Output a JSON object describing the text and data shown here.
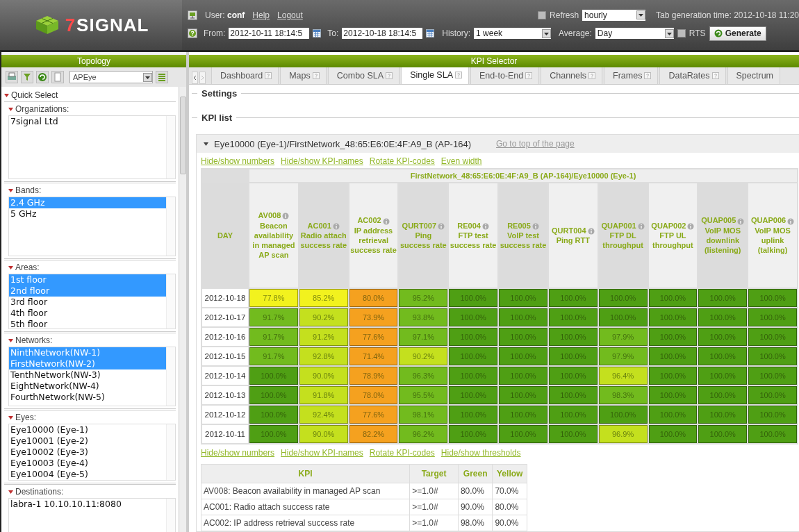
{
  "header": {
    "logo_mark": "7",
    "logo_text": "SIGNAL",
    "user": "User: **conf**",
    "links": [
      "Help",
      "Logout"
    ],
    "refresh": {
      "label": "Refresh",
      "checked": false
    },
    "refresh_select": "hourly",
    "generation_time": "Tab generation time: 2012-10-18 11:20",
    "from": {
      "label": "From:",
      "value": "2012-10-11 18:14:5"
    },
    "to": {
      "label": "To:",
      "value": "2012-10-18 18:14:5"
    },
    "history": {
      "label": "History:",
      "value": "1 week"
    },
    "average": {
      "label": "Average:",
      "value": "Day"
    },
    "rts": {
      "label": "RTS",
      "checked": false
    },
    "generate_button": "Generate"
  },
  "sidebar": {
    "title": "Topology",
    "view_select": "APEye",
    "quick_select": "Quick Select",
    "groups": [
      {
        "label": "Organizations:",
        "items": [
          {
            "text": "7signal Ltd",
            "selected": false
          }
        ]
      },
      {
        "label": "Bands:",
        "items": [
          {
            "text": "2.4 GHz",
            "selected": true
          },
          {
            "text": "5 GHz",
            "selected": false
          }
        ]
      },
      {
        "label": "Areas:",
        "items": [
          {
            "text": "1st floor",
            "selected": true
          },
          {
            "text": "2nd floor",
            "selected": true
          },
          {
            "text": "3rd floor",
            "selected": false
          },
          {
            "text": "4th floor",
            "selected": false
          },
          {
            "text": "5th floor",
            "selected": false
          }
        ]
      },
      {
        "label": "Networks:",
        "items": [
          {
            "text": "NinthNetwork(NW-1)",
            "selected": true
          },
          {
            "text": "FirstNetwork(NW-2)",
            "selected": true
          },
          {
            "text": "TenthNetwork(NW-3)",
            "selected": false
          },
          {
            "text": "EightNetwork(NW-4)",
            "selected": false
          },
          {
            "text": "FourthNetwork(NW-5)",
            "selected": false
          }
        ]
      },
      {
        "label": "Eyes:",
        "items": [
          {
            "text": "Eye10000 (Eye-1)",
            "selected": false
          },
          {
            "text": "Eye10001 (Eye-2)",
            "selected": false
          },
          {
            "text": "Eye10002 (Eye-3)",
            "selected": false
          },
          {
            "text": "Eye10003 (Eye-4)",
            "selected": false
          },
          {
            "text": "Eye10004 (Eye-5)",
            "selected": false
          }
        ]
      },
      {
        "label": "Destinations:",
        "items": [
          {
            "text": "labra-1 10.10.10.11:8080",
            "selected": false
          }
        ]
      }
    ]
  },
  "main": {
    "title": "KPI Selector",
    "tabs": [
      {
        "label": "Dashboard",
        "selected": false
      },
      {
        "label": "Maps",
        "selected": false
      },
      {
        "label": "Combo SLA",
        "selected": false
      },
      {
        "label": "Single SLA",
        "selected": true
      },
      {
        "label": "End-to-End",
        "selected": false
      },
      {
        "label": "Channels",
        "selected": false
      },
      {
        "label": "Frames",
        "selected": false
      },
      {
        "label": "DataRates",
        "selected": false
      },
      {
        "label": "Spectrum",
        "selected": false
      }
    ],
    "settings": "Settings",
    "kpi_list": "KPI list",
    "panel": {
      "title": "Eye10000 (Eye-1)/FirstNetwork_48:65:E6:0E:4F:A9_B (AP-164)",
      "top_link": "Go to top of the page",
      "links_top": [
        "Hide/show numbers",
        "Hide/show KPI-names",
        "Rotate KPI-codes",
        "Even width"
      ],
      "table": {
        "group_header": "FirstNetwork_48:65:E6:0E:4F:A9_B (AP-164)/Eye10000 (Eye-1)",
        "day_header": "DAY",
        "columns": [
          {
            "code": "AV008",
            "name": "Beacon availability in managed AP scan"
          },
          {
            "code": "AC001",
            "name": "Radio attach success rate"
          },
          {
            "code": "AC002",
            "name": "IP address retrieval success rate"
          },
          {
            "code": "QURT007",
            "name": "Ping success rate"
          },
          {
            "code": "RE004",
            "name": "FTP test success rate"
          },
          {
            "code": "RE005",
            "name": "VoIP test success rate"
          },
          {
            "code": "QURT004",
            "name": "Ping RTT"
          },
          {
            "code": "QUAP001",
            "name": "FTP DL throughput"
          },
          {
            "code": "QUAP002",
            "name": "FTP UL throughput"
          },
          {
            "code": "QUAP005",
            "name": "VoIP MOS downlink (listening)"
          },
          {
            "code": "QUAP006",
            "name": "VoIP MOS uplink (talking)"
          }
        ],
        "rows": [
          {
            "day": "2012-10-18",
            "cells": [
              {
                "value": "77.8%",
                "color": "#f2f21e"
              },
              {
                "value": "85.2%",
                "color": "#f2f21e"
              },
              {
                "value": "80.0%",
                "color": "#f5a11f"
              },
              {
                "value": "95.2%",
                "color": "#72bb1e"
              },
              {
                "value": "100.0%",
                "color": "#4f9f14"
              },
              {
                "value": "100.0%",
                "color": "#4f9f14"
              },
              {
                "value": "100.0%",
                "color": "#4f9f14"
              },
              {
                "value": "100.0%",
                "color": "#4f9f14"
              },
              {
                "value": "100.0%",
                "color": "#4f9f14"
              },
              {
                "value": "100.0%",
                "color": "#4f9f14"
              },
              {
                "value": "100.0%",
                "color": "#4f9f14"
              }
            ]
          },
          {
            "day": "2012-10-17",
            "cells": [
              {
                "value": "91.7%",
                "color": "#72bb1e"
              },
              {
                "value": "90.2%",
                "color": "#c4e01e"
              },
              {
                "value": "73.9%",
                "color": "#f5a11f"
              },
              {
                "value": "93.8%",
                "color": "#72bb1e"
              },
              {
                "value": "100.0%",
                "color": "#4f9f14"
              },
              {
                "value": "100.0%",
                "color": "#4f9f14"
              },
              {
                "value": "100.0%",
                "color": "#4f9f14"
              },
              {
                "value": "100.0%",
                "color": "#4f9f14"
              },
              {
                "value": "100.0%",
                "color": "#4f9f14"
              },
              {
                "value": "100.0%",
                "color": "#4f9f14"
              },
              {
                "value": "100.0%",
                "color": "#4f9f14"
              }
            ]
          },
          {
            "day": "2012-10-16",
            "cells": [
              {
                "value": "91.7%",
                "color": "#72bb1e"
              },
              {
                "value": "91.2%",
                "color": "#c4e01e"
              },
              {
                "value": "77.6%",
                "color": "#f5a11f"
              },
              {
                "value": "97.1%",
                "color": "#72bb1e"
              },
              {
                "value": "100.0%",
                "color": "#4f9f14"
              },
              {
                "value": "100.0%",
                "color": "#4f9f14"
              },
              {
                "value": "100.0%",
                "color": "#4f9f14"
              },
              {
                "value": "97.9%",
                "color": "#72bb1e"
              },
              {
                "value": "100.0%",
                "color": "#4f9f14"
              },
              {
                "value": "100.0%",
                "color": "#4f9f14"
              },
              {
                "value": "100.0%",
                "color": "#4f9f14"
              }
            ]
          },
          {
            "day": "2012-10-15",
            "cells": [
              {
                "value": "91.7%",
                "color": "#72bb1e"
              },
              {
                "value": "92.8%",
                "color": "#c4e01e"
              },
              {
                "value": "71.4%",
                "color": "#f5a11f"
              },
              {
                "value": "90.2%",
                "color": "#c4e01e"
              },
              {
                "value": "100.0%",
                "color": "#4f9f14"
              },
              {
                "value": "100.0%",
                "color": "#4f9f14"
              },
              {
                "value": "100.0%",
                "color": "#4f9f14"
              },
              {
                "value": "97.9%",
                "color": "#72bb1e"
              },
              {
                "value": "100.0%",
                "color": "#4f9f14"
              },
              {
                "value": "100.0%",
                "color": "#4f9f14"
              },
              {
                "value": "100.0%",
                "color": "#4f9f14"
              }
            ]
          },
          {
            "day": "2012-10-14",
            "cells": [
              {
                "value": "100.0%",
                "color": "#4f9f14"
              },
              {
                "value": "90.0%",
                "color": "#c4e01e"
              },
              {
                "value": "78.9%",
                "color": "#f5a11f"
              },
              {
                "value": "96.3%",
                "color": "#72bb1e"
              },
              {
                "value": "100.0%",
                "color": "#4f9f14"
              },
              {
                "value": "100.0%",
                "color": "#4f9f14"
              },
              {
                "value": "100.0%",
                "color": "#4f9f14"
              },
              {
                "value": "96.4%",
                "color": "#c4e01e"
              },
              {
                "value": "100.0%",
                "color": "#4f9f14"
              },
              {
                "value": "100.0%",
                "color": "#4f9f14"
              },
              {
                "value": "100.0%",
                "color": "#4f9f14"
              }
            ]
          },
          {
            "day": "2012-10-13",
            "cells": [
              {
                "value": "100.0%",
                "color": "#4f9f14"
              },
              {
                "value": "91.8%",
                "color": "#c4e01e"
              },
              {
                "value": "78.0%",
                "color": "#f5a11f"
              },
              {
                "value": "95.5%",
                "color": "#72bb1e"
              },
              {
                "value": "100.0%",
                "color": "#4f9f14"
              },
              {
                "value": "100.0%",
                "color": "#4f9f14"
              },
              {
                "value": "100.0%",
                "color": "#4f9f14"
              },
              {
                "value": "98.3%",
                "color": "#72bb1e"
              },
              {
                "value": "100.0%",
                "color": "#4f9f14"
              },
              {
                "value": "100.0%",
                "color": "#4f9f14"
              },
              {
                "value": "100.0%",
                "color": "#4f9f14"
              }
            ]
          },
          {
            "day": "2012-10-12",
            "cells": [
              {
                "value": "100.0%",
                "color": "#4f9f14"
              },
              {
                "value": "92.4%",
                "color": "#c4e01e"
              },
              {
                "value": "77.6%",
                "color": "#f5a11f"
              },
              {
                "value": "98.1%",
                "color": "#72bb1e"
              },
              {
                "value": "100.0%",
                "color": "#4f9f14"
              },
              {
                "value": "100.0%",
                "color": "#4f9f14"
              },
              {
                "value": "100.0%",
                "color": "#4f9f14"
              },
              {
                "value": "100.0%",
                "color": "#4f9f14"
              },
              {
                "value": "100.0%",
                "color": "#4f9f14"
              },
              {
                "value": "100.0%",
                "color": "#4f9f14"
              },
              {
                "value": "100.0%",
                "color": "#4f9f14"
              }
            ]
          },
          {
            "day": "2012-10-11",
            "cells": [
              {
                "value": "100.0%",
                "color": "#4f9f14"
              },
              {
                "value": "90.0%",
                "color": "#c4e01e"
              },
              {
                "value": "82.2%",
                "color": "#f5a11f"
              },
              {
                "value": "96.2%",
                "color": "#72bb1e"
              },
              {
                "value": "100.0%",
                "color": "#4f9f14"
              },
              {
                "value": "100.0%",
                "color": "#4f9f14"
              },
              {
                "value": "100.0%",
                "color": "#4f9f14"
              },
              {
                "value": "96.9%",
                "color": "#c4e01e"
              },
              {
                "value": "100.0%",
                "color": "#4f9f14"
              },
              {
                "value": "100.0%",
                "color": "#4f9f14"
              },
              {
                "value": "100.0%",
                "color": "#4f9f14"
              }
            ]
          }
        ]
      },
      "links_bottom": [
        "Hide/show numbers",
        "Hide/show KPI-names",
        "Rotate KPI-codes",
        "Hide/show thresholds"
      ],
      "thresholds": {
        "columns": [
          "KPI",
          "Target",
          "Green",
          "Yellow"
        ],
        "rows": [
          [
            "AV008: Beacon availability in managed AP scan",
            ">=1.0#",
            "80.0%",
            "70.0%"
          ],
          [
            "AC001: Radio attach success rate",
            ">=1.0#",
            "90.0%",
            "80.0%"
          ],
          [
            "AC002: IP address retrieval success rate",
            ">=1.0#",
            "98.0%",
            "90.0%"
          ]
        ]
      }
    }
  }
}
